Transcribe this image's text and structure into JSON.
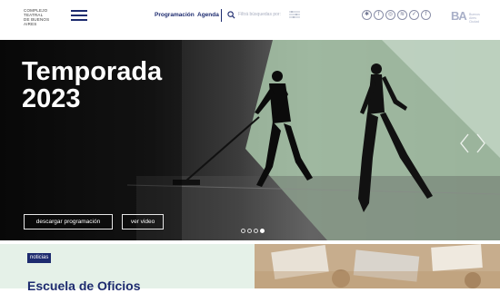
{
  "header": {
    "logo_lines": [
      "COMPLEJO",
      "TEATRAL",
      "DE BUENOS",
      "AIRES"
    ],
    "nav": {
      "programacion": "Programación",
      "agenda": "Agenda"
    },
    "search": {
      "placeholder": "Filtrá búsquedas por:"
    },
    "social_icons": [
      "site-icon",
      "facebook-icon",
      "instagram-icon",
      "spotify-icon",
      "twitter-icon",
      "facebook-icon"
    ],
    "ba_logo": "BA",
    "ba_sub": "Buenos Aires Ciudad"
  },
  "hero": {
    "title_line1": "Temporada",
    "title_line2": "2023",
    "btn_descargar": "descargar programación",
    "btn_video": "ver video",
    "slides_count": 4,
    "active_slide": 4
  },
  "news": {
    "tag": "noticias",
    "headline": "Escuela de Oficios"
  },
  "colors": {
    "brand": "#1d2b6f",
    "news_bg": "#e5f1e8",
    "hero_green": "#a8c6a9"
  }
}
